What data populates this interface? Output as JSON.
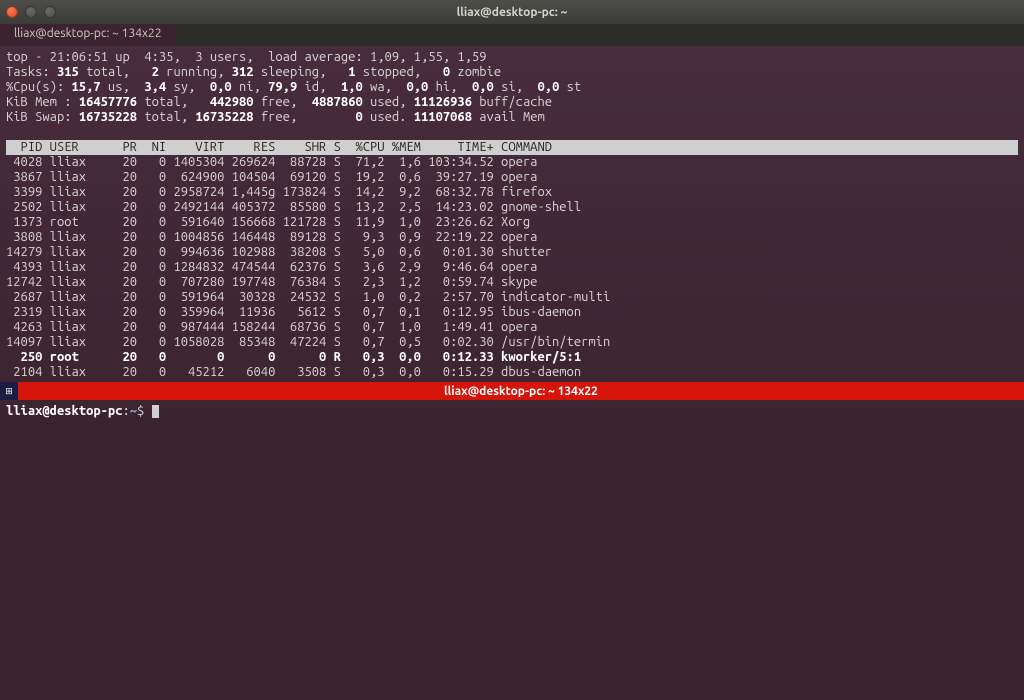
{
  "window": {
    "title": "lliax@desktop-pc: ~"
  },
  "tab": {
    "label": "lliax@desktop-pc: ~ 134x22"
  },
  "top": {
    "time": "21:06:51",
    "uptime": "4:35",
    "users": "3 users",
    "load_avg": "1,09, 1,55, 1,59",
    "tasks": {
      "total": "315",
      "running": "2",
      "sleeping": "312",
      "stopped": "1",
      "zombie": "0"
    },
    "cpu": {
      "us": "15,7",
      "sy": "3,4",
      "ni": "0,0",
      "id": "79,9",
      "wa": "1,0",
      "hi": "0,0",
      "si": "0,0",
      "st": "0,0"
    },
    "mem": {
      "total": "16457776",
      "free": "442980",
      "used": "4887860",
      "buff": "11126936"
    },
    "swap": {
      "total": "16735228",
      "free": "16735228",
      "used": "0",
      "avail": "11107068"
    }
  },
  "header": "  PID USER      PR  NI    VIRT    RES    SHR S  %CPU %MEM     TIME+ COMMAND                                                            ",
  "rows": [
    {
      "pid": "4028",
      "user": "lliax",
      "pr": "20",
      "ni": "0",
      "virt": "1405304",
      "res": "269624",
      "shr": "88728",
      "s": "S",
      "cpu": "71,2",
      "mem": "1,6",
      "time": "103:34.52",
      "cmd": "opera",
      "bold": false
    },
    {
      "pid": "3867",
      "user": "lliax",
      "pr": "20",
      "ni": "0",
      "virt": "624900",
      "res": "104504",
      "shr": "69120",
      "s": "S",
      "cpu": "19,2",
      "mem": "0,6",
      "time": "39:27.19",
      "cmd": "opera",
      "bold": false
    },
    {
      "pid": "3399",
      "user": "lliax",
      "pr": "20",
      "ni": "0",
      "virt": "2958724",
      "res": "1,445g",
      "shr": "173824",
      "s": "S",
      "cpu": "14,2",
      "mem": "9,2",
      "time": "68:32.78",
      "cmd": "firefox",
      "bold": false
    },
    {
      "pid": "2502",
      "user": "lliax",
      "pr": "20",
      "ni": "0",
      "virt": "2492144",
      "res": "405372",
      "shr": "85580",
      "s": "S",
      "cpu": "13,2",
      "mem": "2,5",
      "time": "14:23.02",
      "cmd": "gnome-shell",
      "bold": false
    },
    {
      "pid": "1373",
      "user": "root",
      "pr": "20",
      "ni": "0",
      "virt": "591640",
      "res": "156668",
      "shr": "121728",
      "s": "S",
      "cpu": "11,9",
      "mem": "1,0",
      "time": "23:26.62",
      "cmd": "Xorg",
      "bold": false
    },
    {
      "pid": "3808",
      "user": "lliax",
      "pr": "20",
      "ni": "0",
      "virt": "1004856",
      "res": "146448",
      "shr": "89128",
      "s": "S",
      "cpu": "9,3",
      "mem": "0,9",
      "time": "22:19.22",
      "cmd": "opera",
      "bold": false
    },
    {
      "pid": "14279",
      "user": "lliax",
      "pr": "20",
      "ni": "0",
      "virt": "994636",
      "res": "102988",
      "shr": "38208",
      "s": "S",
      "cpu": "5,0",
      "mem": "0,6",
      "time": "0:01.30",
      "cmd": "shutter",
      "bold": false
    },
    {
      "pid": "4393",
      "user": "lliax",
      "pr": "20",
      "ni": "0",
      "virt": "1284832",
      "res": "474544",
      "shr": "62376",
      "s": "S",
      "cpu": "3,6",
      "mem": "2,9",
      "time": "9:46.64",
      "cmd": "opera",
      "bold": false
    },
    {
      "pid": "12742",
      "user": "lliax",
      "pr": "20",
      "ni": "0",
      "virt": "707280",
      "res": "197748",
      "shr": "76384",
      "s": "S",
      "cpu": "2,3",
      "mem": "1,2",
      "time": "0:59.74",
      "cmd": "skype",
      "bold": false
    },
    {
      "pid": "2687",
      "user": "lliax",
      "pr": "20",
      "ni": "0",
      "virt": "591964",
      "res": "30328",
      "shr": "24532",
      "s": "S",
      "cpu": "1,0",
      "mem": "0,2",
      "time": "2:57.70",
      "cmd": "indicator-multi",
      "bold": false
    },
    {
      "pid": "2319",
      "user": "lliax",
      "pr": "20",
      "ni": "0",
      "virt": "359964",
      "res": "11936",
      "shr": "5612",
      "s": "S",
      "cpu": "0,7",
      "mem": "0,1",
      "time": "0:12.95",
      "cmd": "ibus-daemon",
      "bold": false
    },
    {
      "pid": "4263",
      "user": "lliax",
      "pr": "20",
      "ni": "0",
      "virt": "987444",
      "res": "158244",
      "shr": "68736",
      "s": "S",
      "cpu": "0,7",
      "mem": "1,0",
      "time": "1:49.41",
      "cmd": "opera",
      "bold": false
    },
    {
      "pid": "14097",
      "user": "lliax",
      "pr": "20",
      "ni": "0",
      "virt": "1058028",
      "res": "85348",
      "shr": "47224",
      "s": "S",
      "cpu": "0,7",
      "mem": "0,5",
      "time": "0:02.30",
      "cmd": "/usr/bin/termin",
      "bold": false
    },
    {
      "pid": "250",
      "user": "root",
      "pr": "20",
      "ni": "0",
      "virt": "0",
      "res": "0",
      "shr": "0",
      "s": "R",
      "cpu": "0,3",
      "mem": "0,0",
      "time": "0:12.33",
      "cmd": "kworker/5:1",
      "bold": true
    },
    {
      "pid": "2104",
      "user": "lliax",
      "pr": "20",
      "ni": "0",
      "virt": "45212",
      "res": "6040",
      "shr": "3508",
      "s": "S",
      "cpu": "0,3",
      "mem": "0,0",
      "time": "0:15.29",
      "cmd": "dbus-daemon",
      "bold": false
    }
  ],
  "divider": {
    "title": "lliax@desktop-pc: ~ 134x22"
  },
  "prompt": {
    "user_host": "lliax@desktop-pc",
    "path": "~",
    "sep": ":",
    "suffix": "$ "
  }
}
